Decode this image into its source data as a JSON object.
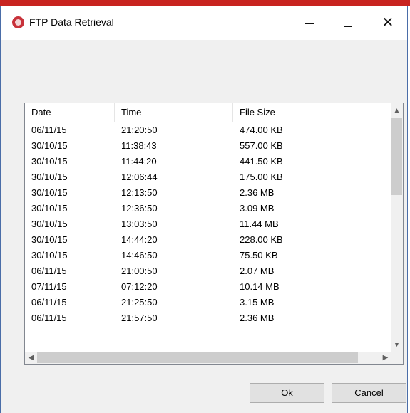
{
  "window": {
    "title": "FTP Data Retrieval",
    "buttons": {
      "minimize": "—",
      "maximize": "☐",
      "close": "✕"
    }
  },
  "list": {
    "columns": [
      "Date",
      "Time",
      "File Size"
    ],
    "rows": [
      [
        "06/11/15",
        "21:20:50",
        "474.00 KB"
      ],
      [
        "30/10/15",
        "11:38:43",
        "557.00 KB"
      ],
      [
        "30/10/15",
        "11:44:20",
        "441.50 KB"
      ],
      [
        "30/10/15",
        "12:06:44",
        "175.00 KB"
      ],
      [
        "30/10/15",
        "12:13:50",
        "2.36 MB"
      ],
      [
        "30/10/15",
        "12:36:50",
        "3.09 MB"
      ],
      [
        "30/10/15",
        "13:03:50",
        "11.44 MB"
      ],
      [
        "30/10/15",
        "14:44:20",
        "228.00 KB"
      ],
      [
        "30/10/15",
        "14:46:50",
        "75.50 KB"
      ],
      [
        "06/11/15",
        "21:00:50",
        "2.07 MB"
      ],
      [
        "07/11/15",
        "07:12:20",
        "10.14 MB"
      ],
      [
        "06/11/15",
        "21:25:50",
        "3.15 MB"
      ],
      [
        "06/11/15",
        "21:57:50",
        "2.36 MB"
      ]
    ]
  },
  "footer": {
    "ok_label": "Ok",
    "cancel_label": "Cancel"
  },
  "colors": {
    "accent_bar": "#c8231f",
    "window_border": "#4a6da8",
    "dialog_bg": "#f0f0f0"
  }
}
